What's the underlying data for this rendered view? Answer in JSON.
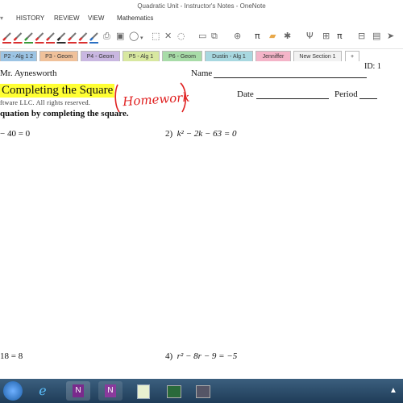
{
  "window": {
    "title": "Quadratic Unit - Instructor's Notes - OneNote"
  },
  "menu": {
    "items": [
      "HISTORY",
      "REVIEW",
      "VIEW",
      "Mathematics"
    ]
  },
  "ribbon": {
    "pen_colors": [
      "#d93030",
      "#d93030",
      "#3a9a3a",
      "#d93030",
      "#d93030",
      "#2a2a2a",
      "#d93030",
      "#d93030",
      "#2a6fc2"
    ],
    "icons": [
      "print-icon",
      "image-icon",
      "circle-icon",
      "select-icon",
      "delete-icon",
      "lasso-icon",
      "shape-icon",
      "layers-icon",
      "camera-icon",
      "pi-icon",
      "eraser-icon",
      "star-icon",
      "psi-icon",
      "grid-icon",
      "pi-icon",
      "calculator-icon",
      "arrow-icon"
    ]
  },
  "tabs": [
    {
      "label": "P2 - Alg 1 2",
      "color": "#9cc4e4"
    },
    {
      "label": "P3 - Geom",
      "color": "#f0c19a"
    },
    {
      "label": "P4 - Geom",
      "color": "#c9b7e1"
    },
    {
      "label": "P5 - Alg 1",
      "color": "#d8e8a0"
    },
    {
      "label": "P6 - Geom",
      "color": "#a8dca8"
    },
    {
      "label": "Dustin - Alg 1",
      "color": "#a8d8e0"
    },
    {
      "label": "Jenniffer",
      "color": "#f4b4c8"
    },
    {
      "label": "New Section 1",
      "color": "#f2f2f2"
    },
    {
      "label": "+",
      "color": "#ffffff"
    }
  ],
  "worksheet": {
    "id": "ID: 1",
    "teacher": "Mr. Aynesworth",
    "name_label": "Name",
    "heading": "Completing the Square",
    "annotation": "Homework",
    "copyright": "ftware LLC.  All rights reserved.",
    "date_label": "Date",
    "period_label": "Period",
    "instructions": "quation by completing the square.",
    "problems": [
      {
        "num": "",
        "text": "− 40 = 0"
      },
      {
        "num": "2)",
        "text": "k² − 2k − 63 = 0"
      },
      {
        "num": "",
        "text": "18 = 8"
      },
      {
        "num": "4)",
        "text": "r² − 8r − 9 = −5"
      }
    ]
  },
  "taskbar": {
    "items": [
      "start-button",
      "explorer-icon",
      "chrome-icon",
      "onenote-icon",
      "onenote-icon",
      "notes-icon",
      "app-icon",
      "app-icon"
    ]
  }
}
